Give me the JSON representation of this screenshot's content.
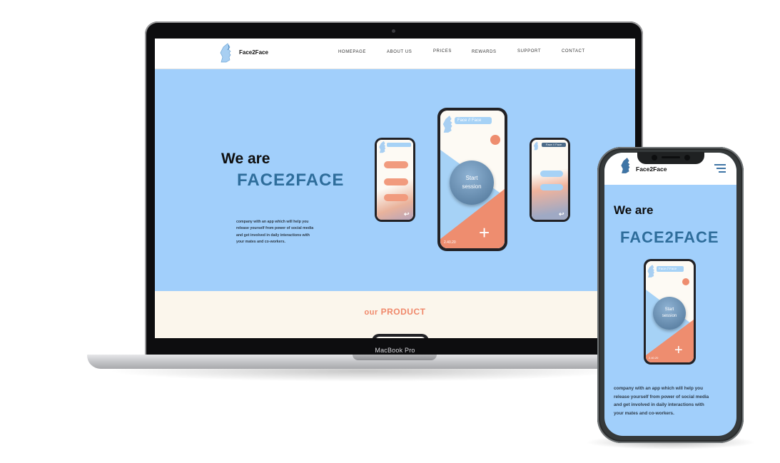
{
  "laptop": {
    "model_label": "MacBook Pro"
  },
  "site": {
    "brand": "Face2Face",
    "nav": [
      "HOMEPAGE",
      "ABOUT US",
      "PRICES",
      "REWARDS",
      "SUPPORT",
      "CONTACT"
    ],
    "hero_we_are": "We are",
    "hero_brand": "FACE2FACE",
    "hero_description_lines": [
      "company with an app which will help you",
      "release yourself from power of social media",
      "and get involved in daily interactions with",
      "your mates and co-workers."
    ],
    "product_heading_prefix": "our",
    "product_heading_main": "PRODUCT"
  },
  "app_mockups": {
    "center_header": "Face // Face",
    "start_session_line1": "Start",
    "start_session_line2": "session",
    "timer": "2.40.20",
    "right_header": "Face // Face"
  },
  "phone": {
    "brand": "Face2Face",
    "hero_we_are": "We are",
    "hero_brand": "FACE2FACE",
    "description_lines": [
      "company with an app which will help you",
      "release yourself from power of social media",
      "and get involved in daily interactions with",
      "your mates and co-workers."
    ]
  },
  "colors": {
    "hero_bg": "#a1cffb",
    "brand_blue": "#2e6d9b",
    "accent_orange": "#f0886a",
    "cream": "#fbf6ec"
  }
}
